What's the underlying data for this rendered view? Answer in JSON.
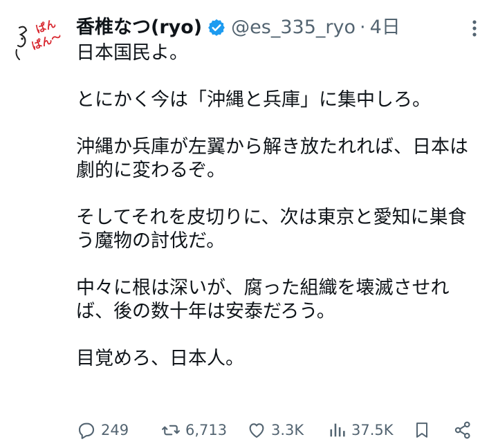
{
  "tweet": {
    "display_name": "香椎なつ(ryo)",
    "handle": "@es_335_ryo",
    "separator": "·",
    "time": "4日",
    "avatar_icon": "cartoon-avatar-icon",
    "verified_icon": "verified-badge-icon",
    "accent_color": "#1d9bf0",
    "avatar_text": "ぱんぱん〜",
    "paragraphs": [
      "日本国民よ。",
      "とにかく今は「沖縄と兵庫」に集中しろ。",
      "沖縄か兵庫が左翼から解き放たれれば、日本は\n劇的に変わるぞ。",
      "そしてそれを皮切りに、次は東京と愛知に巣食\nう魔物の討伐だ。",
      "中々に根は深いが、腐った組織を壊滅させれ\nば、後の数十年は安泰だろう。",
      "目覚めろ、日本人。"
    ]
  },
  "actions": {
    "reply_count": "249",
    "retweet_count": "6,713",
    "like_count": "3.3K",
    "views_count": "37.5K",
    "icons": [
      "reply-icon",
      "retweet-icon",
      "like-icon",
      "views-icon",
      "bookmark-icon",
      "share-icon",
      "more-icon"
    ]
  }
}
